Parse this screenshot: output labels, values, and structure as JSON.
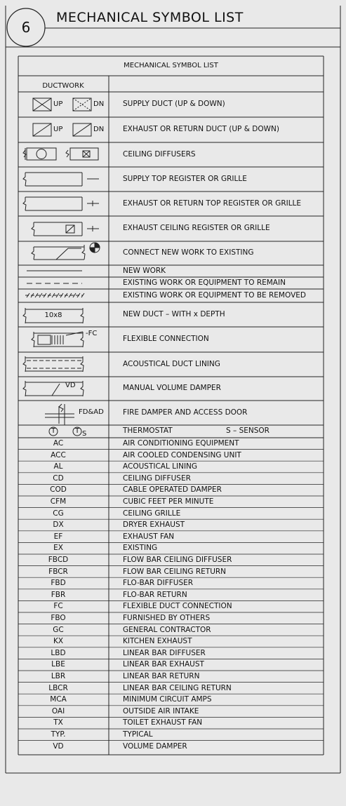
{
  "sheet": {
    "number": "6",
    "title": "MECHANICAL SYMBOL LIST"
  },
  "table": {
    "title": "MECHANICAL SYMBOL LIST",
    "section_label": "DUCTWORK",
    "symbol_rows": [
      {
        "symbol_text": "UP  DN",
        "desc": "SUPPLY DUCT (UP & DOWN)",
        "icon": "supply-duct-up-down-icon"
      },
      {
        "symbol_text": "UP  DN",
        "desc": "EXHAUST OR RETURN DUCT (UP & DOWN)",
        "icon": "exhaust-duct-up-down-icon"
      },
      {
        "symbol_text": "",
        "desc": "CEILING DIFFUSERS",
        "icon": "ceiling-diffuser-icon"
      },
      {
        "symbol_text": "",
        "desc": "SUPPLY TOP REGISTER OR GRILLE",
        "icon": "supply-top-register-icon"
      },
      {
        "symbol_text": "",
        "desc": "EXHAUST OR RETURN TOP REGISTER OR GRILLE",
        "icon": "exhaust-top-register-icon"
      },
      {
        "symbol_text": "",
        "desc": "EXHAUST CEILING REGISTER OR GRILLE",
        "icon": "exhaust-ceiling-register-icon"
      },
      {
        "symbol_text": "",
        "desc": "CONNECT NEW WORK TO EXISTING",
        "icon": "connect-new-to-existing-icon"
      },
      {
        "symbol_text": "",
        "desc": "NEW WORK",
        "icon": "new-work-line-icon"
      },
      {
        "symbol_text": "",
        "desc": "EXISTING WORK OR EQUIPMENT TO REMAIN",
        "icon": "existing-remain-dashed-line-icon"
      },
      {
        "symbol_text": "",
        "desc": "EXISTING WORK OR EQUIPMENT TO BE REMOVED",
        "icon": "existing-removed-hatched-line-icon"
      },
      {
        "symbol_text": "10x8",
        "desc": "NEW DUCT – WITH x DEPTH",
        "icon": "new-duct-size-icon"
      },
      {
        "symbol_text": "FC",
        "desc": "FLEXIBLE CONNECTION",
        "icon": "flexible-connection-icon"
      },
      {
        "symbol_text": "",
        "desc": "ACOUSTICAL DUCT LINING",
        "icon": "acoustical-lining-icon"
      },
      {
        "symbol_text": "VD",
        "desc": "MANUAL VOLUME DAMPER",
        "icon": "volume-damper-icon"
      },
      {
        "symbol_text": "FD&AD",
        "desc": "FIRE DAMPER AND ACCESS DOOR",
        "icon": "fire-damper-icon"
      },
      {
        "symbol_text": "T  T S",
        "desc": "THERMOSTAT",
        "desc2": "S – SENSOR",
        "icon": "thermostat-sensor-icon"
      }
    ],
    "abbreviations": [
      {
        "abbr": "AC",
        "desc": "AIR CONDITIONING EQUIPMENT"
      },
      {
        "abbr": "ACC",
        "desc": "AIR COOLED CONDENSING UNIT"
      },
      {
        "abbr": "AL",
        "desc": "ACOUSTICAL LINING"
      },
      {
        "abbr": "CD",
        "desc": "CEILING DIFFUSER"
      },
      {
        "abbr": "COD",
        "desc": "CABLE OPERATED DAMPER"
      },
      {
        "abbr": "CFM",
        "desc": "CUBIC FEET PER MINUTE"
      },
      {
        "abbr": "CG",
        "desc": "CEILING GRILLE"
      },
      {
        "abbr": "DX",
        "desc": "DRYER EXHAUST"
      },
      {
        "abbr": "EF",
        "desc": "EXHAUST FAN"
      },
      {
        "abbr": "EX",
        "desc": "EXISTING"
      },
      {
        "abbr": "FBCD",
        "desc": "FLOW BAR CEILING DIFFUSER"
      },
      {
        "abbr": "FBCR",
        "desc": "FLOW BAR CEILING RETURN"
      },
      {
        "abbr": "FBD",
        "desc": "FLO-BAR DIFFUSER"
      },
      {
        "abbr": "FBR",
        "desc": "FLO-BAR RETURN"
      },
      {
        "abbr": "FC",
        "desc": "FLEXIBLE DUCT CONNECTION"
      },
      {
        "abbr": "FBO",
        "desc": "FURNISHED BY OTHERS"
      },
      {
        "abbr": "GC",
        "desc": "GENERAL CONTRACTOR"
      },
      {
        "abbr": "KX",
        "desc": "KITCHEN EXHAUST"
      },
      {
        "abbr": "LBD",
        "desc": "LINEAR BAR DIFFUSER"
      },
      {
        "abbr": "LBE",
        "desc": "LINEAR BAR EXHAUST"
      },
      {
        "abbr": "LBR",
        "desc": "LINEAR BAR RETURN"
      },
      {
        "abbr": "LBCR",
        "desc": "LINEAR BAR CEILING RETURN"
      },
      {
        "abbr": "MCA",
        "desc": "MINIMUM CIRCUIT AMPS"
      },
      {
        "abbr": "OAI",
        "desc": "OUTSIDE AIR INTAKE"
      },
      {
        "abbr": "TX",
        "desc": "TOILET EXHAUST FAN"
      },
      {
        "abbr": "TYP.",
        "desc": "TYPICAL"
      },
      {
        "abbr": "VD",
        "desc": "VOLUME DAMPER"
      }
    ]
  }
}
